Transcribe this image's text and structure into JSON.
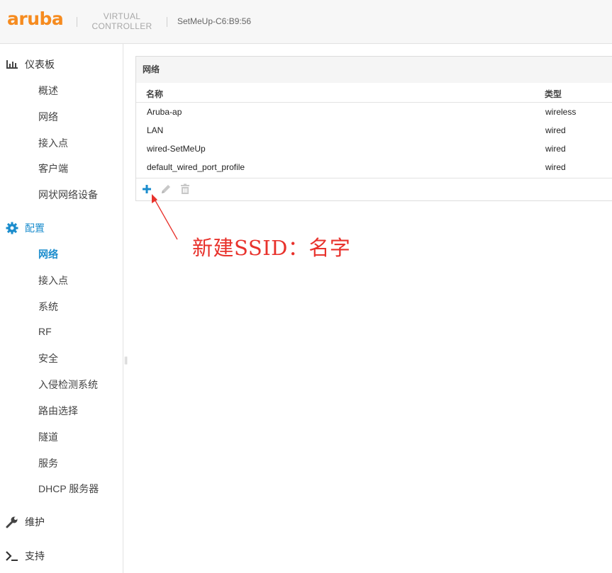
{
  "header": {
    "logo_text": "aruba",
    "product_line1": "VIRTUAL",
    "product_line2": "CONTROLLER",
    "device_name": "SetMeUp-C6:B9:56"
  },
  "sidebar": {
    "dashboard": {
      "label": "仪表板",
      "icon": "bar-chart-icon",
      "items": [
        "概述",
        "网络",
        "接入点",
        "客户端",
        "网状网络设备"
      ]
    },
    "config": {
      "label": "配置",
      "icon": "gear-icon",
      "items": [
        "网络",
        "接入点",
        "系统",
        "RF",
        "安全",
        "入侵检测系统",
        "路由选择",
        "隧道",
        "服务",
        "DHCP 服务器"
      ],
      "active_item": "网络"
    },
    "maintenance": {
      "label": "维护",
      "icon": "wrench-icon"
    },
    "support": {
      "label": "支持",
      "icon": "terminal-icon"
    }
  },
  "panel": {
    "title": "网络",
    "columns": {
      "name": "名称",
      "type": "类型"
    },
    "rows": [
      {
        "name": "Aruba-ap",
        "type": "wireless"
      },
      {
        "name": "LAN",
        "type": "wired"
      },
      {
        "name": "wired-SetMeUp",
        "type": "wired"
      },
      {
        "name": "default_wired_port_profile",
        "type": "wired"
      }
    ],
    "toolbar": [
      "plus-icon",
      "pencil-icon",
      "trash-icon"
    ]
  },
  "annotation": {
    "text": "新建SSID：名字",
    "color": "#e8322c"
  },
  "colors": {
    "brand": "#f68b1f",
    "accent": "#1a8ccd"
  }
}
